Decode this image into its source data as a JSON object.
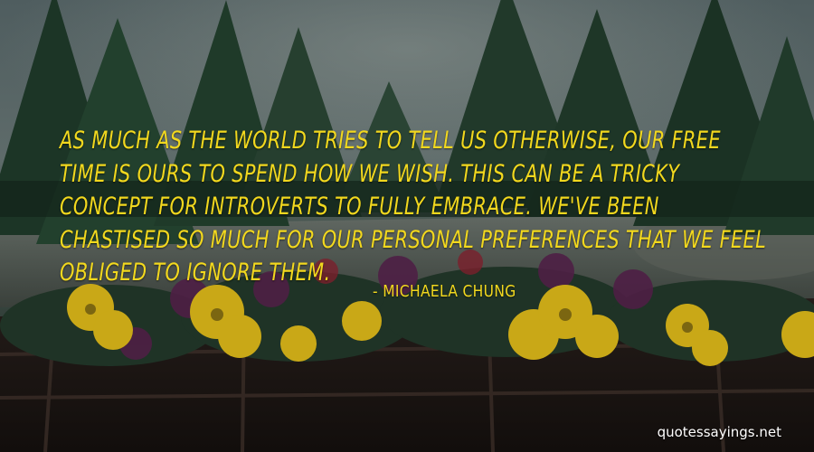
{
  "quote": {
    "lines": [
      "As much as the world tries to tell us otherwise, our free",
      "time is ours to spend how we wish. This can be a tricky",
      "concept for introverts to fully embrace. We've been",
      "chastised so much for our personal preferences that we feel",
      "obliged to ignore them."
    ],
    "author": "- Michaela Chung"
  },
  "watermark": "quotessayings.net",
  "colors": {
    "quote_text": "#f2d81e",
    "watermark_text": "#ffffff",
    "sky": "#5a6a6c",
    "foliage": "#1f3a2a",
    "flower_yellow": "#d9b81a",
    "flower_purple": "#5a2350"
  }
}
